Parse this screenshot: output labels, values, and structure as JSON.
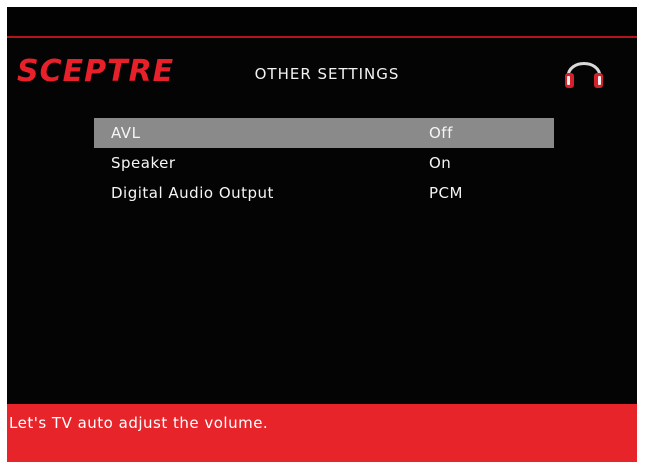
{
  "brand": {
    "logo_text": "SCEPTRE",
    "color": "#e8202a"
  },
  "header": {
    "title": "OTHER SETTINGS",
    "icon": "headphones-icon"
  },
  "menu": {
    "items": [
      {
        "label": "AVL",
        "value": "Off",
        "selected": true
      },
      {
        "label": "Speaker",
        "value": "On",
        "selected": false
      },
      {
        "label": "Digital Audio Output",
        "value": "PCM",
        "selected": false
      }
    ]
  },
  "help": {
    "text": "Let's TV auto adjust the volume."
  },
  "colors": {
    "background": "#040404",
    "accent_red": "#e8242b",
    "selection": "#8a8a8a"
  }
}
